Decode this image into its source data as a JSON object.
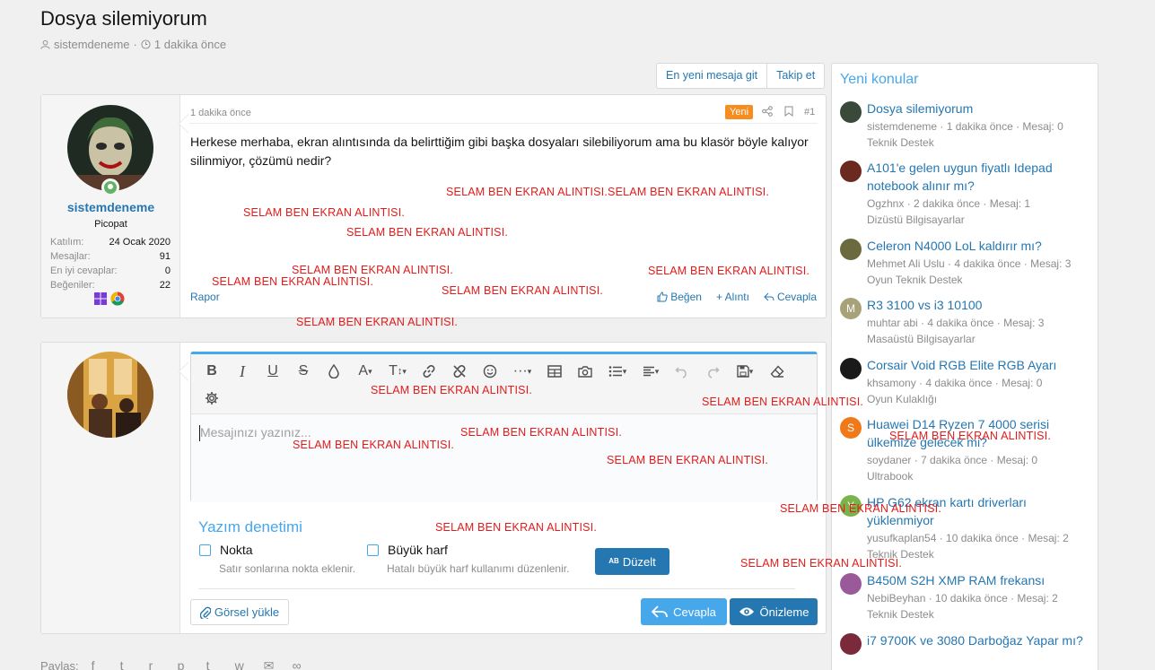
{
  "thread": {
    "title": "Dosya silemiyorum",
    "author": "sistemdeneme",
    "time": "1 dakika önce"
  },
  "actions": {
    "latest": "En yeni mesaja git",
    "follow": "Takip et"
  },
  "post": {
    "time": "1 dakika önce",
    "badge": "Yeni",
    "number": "#1",
    "body": "Herkese merhaba, ekran alıntısında da belirttiğim gibi başka dosyaları silebiliyorum ama bu klasör böyle kalıyor silinmiyor, çözümü nedir?",
    "report": "Rapor",
    "like": "Beğen",
    "quote": "+ Alıntı",
    "reply": "Cevapla",
    "user": {
      "name": "sistemdeneme",
      "title": "Picopat",
      "stats": [
        {
          "k": "Katılım:",
          "v": "24 Ocak 2020"
        },
        {
          "k": "Mesajlar:",
          "v": "91"
        },
        {
          "k": "En iyi cevaplar:",
          "v": "0"
        },
        {
          "k": "Beğeniler:",
          "v": "22"
        }
      ]
    }
  },
  "editor": {
    "placeholder": "Mesajınızı yazınız...",
    "spell_title": "Yazım denetimi",
    "dot_label": "Nokta",
    "dot_desc": "Satır sonlarına nokta eklenir.",
    "caps_label": "Büyük harf",
    "caps_desc": "Hatalı büyük harf kullanımı düzenlenir.",
    "fix_ab": "AB",
    "fix_label": "Düzelt",
    "upload_label": "Görsel yükle",
    "reply_label": "Cevapla",
    "preview_label": "Önizleme"
  },
  "share": {
    "label": "Paylaş:"
  },
  "sidebar": {
    "title": "Yeni konular",
    "threads": [
      {
        "title": "Dosya silemiyorum",
        "meta": "sistemdeneme · 1 dakika önce · Mesaj: 0",
        "forum": "Teknik Destek",
        "avatar": "",
        "color": "#3a4a3a"
      },
      {
        "title": "A101'e gelen uygun fiyatlı Idepad notebook alınır mı?",
        "meta": "Ogzhnx · 2 dakika önce · Mesaj: 1",
        "forum": "Dizüstü Bilgisayarlar",
        "avatar": "",
        "color": "#6b2a20"
      },
      {
        "title": "Celeron N4000 LoL kaldırır mı?",
        "meta": "Mehmet Ali Uslu · 4 dakika önce · Mesaj: 3",
        "forum": "Oyun Teknik Destek",
        "avatar": "",
        "color": "#6b6a3e"
      },
      {
        "title": "R3 3100 vs i3 10100",
        "meta": "muhtar abi · 4 dakika önce · Mesaj: 3",
        "forum": "Masaüstü Bilgisayarlar",
        "avatar": "M",
        "color": "#a8a27a"
      },
      {
        "title": "Corsair Void RGB Elite RGB Ayarı",
        "meta": "khsamony · 4 dakika önce · Mesaj: 0",
        "forum": "Oyun Kulaklığı",
        "avatar": "",
        "color": "#1a1a1a"
      },
      {
        "title": "Huawei D14 Ryzen 7 4000 serisi ülkemize gelecek mi?",
        "meta": "soydaner · 7 dakika önce · Mesaj: 0",
        "forum": "Ultrabook",
        "avatar": "S",
        "color": "#f07a1a"
      },
      {
        "title": "HP G62 ekran kartı driverları yüklenmiyor",
        "meta": "yusufkaplan54 · 10 dakika önce · Mesaj: 2",
        "forum": "Teknik Destek",
        "avatar": "Y",
        "color": "#7ab34a"
      },
      {
        "title": "B450M S2H XMP RAM frekansı",
        "meta": "NebiBeyhan · 10 dakika önce · Mesaj: 2",
        "forum": "Teknik Destek",
        "avatar": "",
        "color": "#9a5a9a"
      },
      {
        "title": "i7 9700K ve 3080 Darboğaz Yapar mı?",
        "meta": "",
        "forum": "",
        "avatar": "",
        "color": "#7a2a3a"
      }
    ]
  },
  "overlay_text": "SELAM BEN EKRAN ALINTISI.",
  "overlay_text_double": "SELAM BEN EKRAN ALINTISI.SELAM BEN EKRAN ALINTISI."
}
